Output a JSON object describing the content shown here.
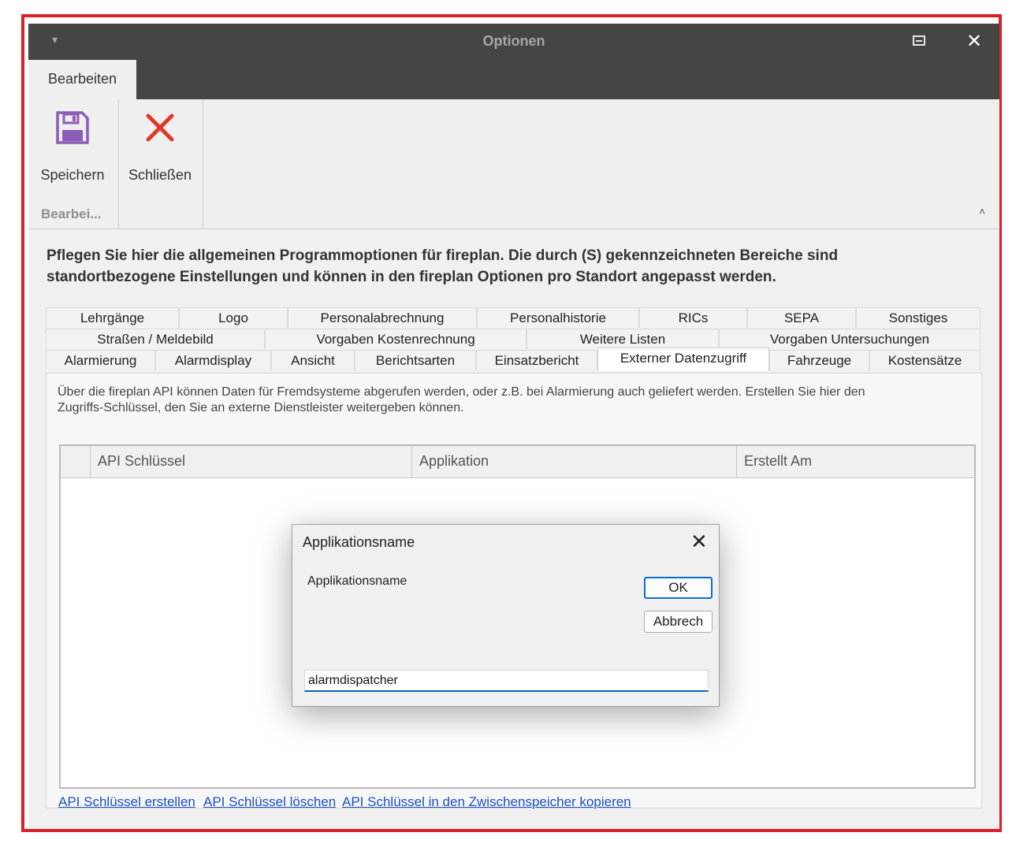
{
  "window": {
    "title": "Optionen",
    "menu_glyph": "▾",
    "close_glyph": "✕"
  },
  "ribbon": {
    "active_tab": "Bearbeiten",
    "group_label": "Bearbei...",
    "buttons": {
      "save": {
        "label": "Speichern",
        "icon": "floppy-disk-icon",
        "color": "#8b5db8"
      },
      "close": {
        "label": "Schließen",
        "icon": "red-x-icon",
        "color": "#e03a2a"
      }
    },
    "collapse_glyph": "˄"
  },
  "intro": "Pflegen Sie hier die allgemeinen Programmoptionen für fireplan. Die durch (S) gekennzeichneten Bereiche sind standortbezogene Einstellungen und können in den fireplan Optionen pro Standort angepasst werden.",
  "tabs": {
    "row1": [
      "Lehrgänge",
      "Logo",
      "Personalabrechnung",
      "Personalhistorie",
      "RICs",
      "SEPA",
      "Sonstiges"
    ],
    "row2": [
      "Straßen / Meldebild",
      "Vorgaben Kostenrechnung",
      "Weitere Listen",
      "Vorgaben Untersuchungen"
    ],
    "row3": [
      "Alarmierung",
      "Alarmdisplay",
      "Ansicht",
      "Berichtsarten",
      "Einsatzbericht",
      "Externer Datenzugriff",
      "Fahrzeuge",
      "Kostensätze"
    ],
    "active": "Externer Datenzugriff"
  },
  "page": {
    "description": "Über die fireplan API können Daten für Fremdsysteme abgerufen werden, oder z.B. bei Alarmierung auch geliefert werden. Erstellen Sie hier den Zugriffs-Schlüssel, den Sie an externe Dienstleister weitergeben können.",
    "columns": [
      "API Schlüssel",
      "Applikation",
      "Erstellt Am"
    ],
    "links": [
      "API Schlüssel erstellen",
      "API Schlüssel löschen",
      "API Schlüssel in den Zwischenspeicher kopieren"
    ]
  },
  "dialog": {
    "title": "Applikationsname",
    "prompt": "Applikationsname",
    "ok": "OK",
    "cancel": "Abbrech",
    "input_value": "alarmdispatcher",
    "close_glyph": "✕"
  },
  "colors": {
    "frame": "#d9202a",
    "titlebar": "#454545",
    "link": "#1a4fc4",
    "focus": "#0b6dd8"
  }
}
